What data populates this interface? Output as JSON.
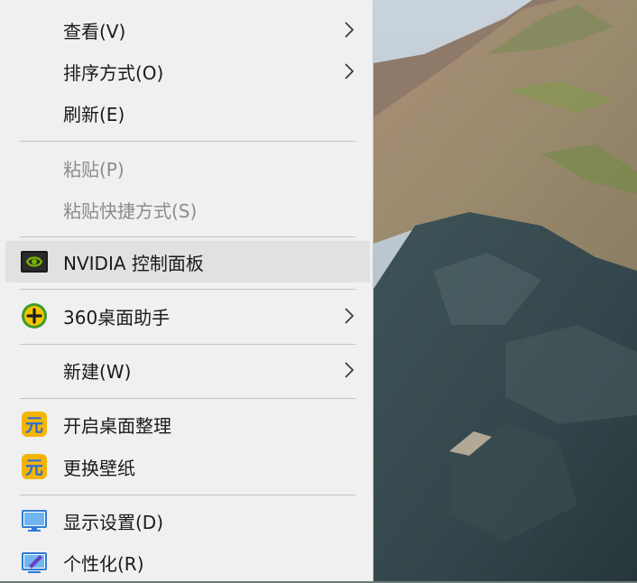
{
  "menu": {
    "items": [
      {
        "label": "查看(V)",
        "submenu": true,
        "disabled": false
      },
      {
        "label": "排序方式(O)",
        "submenu": true,
        "disabled": false
      },
      {
        "label": "刷新(E)",
        "submenu": false,
        "disabled": false
      },
      {
        "label": "粘贴(P)",
        "submenu": false,
        "disabled": true
      },
      {
        "label": "粘贴快捷方式(S)",
        "submenu": false,
        "disabled": true
      },
      {
        "label": "NVIDIA 控制面板",
        "submenu": false,
        "disabled": false,
        "icon": "nvidia-icon",
        "highlighted": true
      },
      {
        "label": "360桌面助手",
        "submenu": true,
        "disabled": false,
        "icon": "360-assistant-icon"
      },
      {
        "label": "新建(W)",
        "submenu": true,
        "disabled": false
      },
      {
        "label": "开启桌面整理",
        "submenu": false,
        "disabled": false,
        "icon": "desktop-organize-icon"
      },
      {
        "label": "更换壁纸",
        "submenu": false,
        "disabled": false,
        "icon": "wallpaper-icon"
      },
      {
        "label": "显示设置(D)",
        "submenu": false,
        "disabled": false,
        "icon": "display-settings-icon"
      },
      {
        "label": "个性化(R)",
        "submenu": false,
        "disabled": false,
        "icon": "personalize-icon"
      }
    ]
  },
  "colors": {
    "menu_bg": "#f0f0f0",
    "highlight_bg": "#e1e1e1",
    "disabled_text": "#8c8c8c",
    "nvidia_green": "#76b900",
    "assistant_yellow": "#f5c400"
  }
}
